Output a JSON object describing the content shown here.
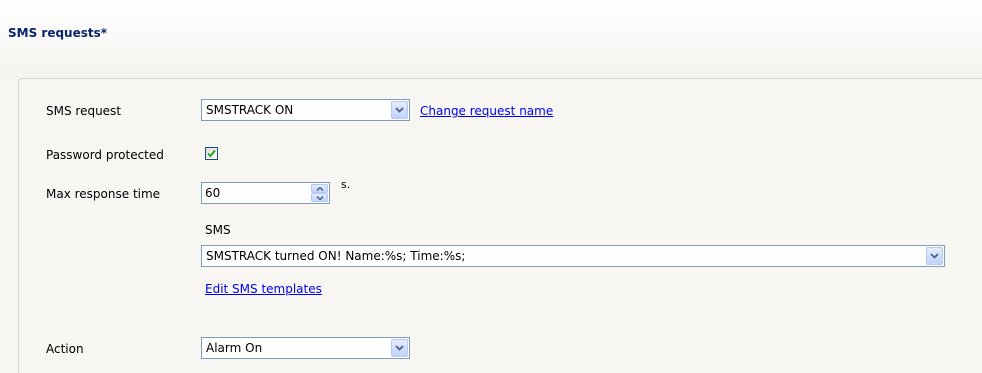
{
  "header": {
    "title": "SMS requests*"
  },
  "form": {
    "sms_request": {
      "label": "SMS request",
      "value": "SMSTRACK ON",
      "link": "Change request name"
    },
    "password_protected": {
      "label": "Password protected",
      "checked": true
    },
    "max_response_time": {
      "label": "Max response time",
      "value": "60",
      "unit": "s."
    },
    "sms": {
      "label": "SMS",
      "value": "SMSTRACK turned ON! Name:%s; Time:%s;",
      "link": "Edit SMS templates"
    },
    "action": {
      "label": "Action",
      "value": "Alarm On"
    }
  }
}
